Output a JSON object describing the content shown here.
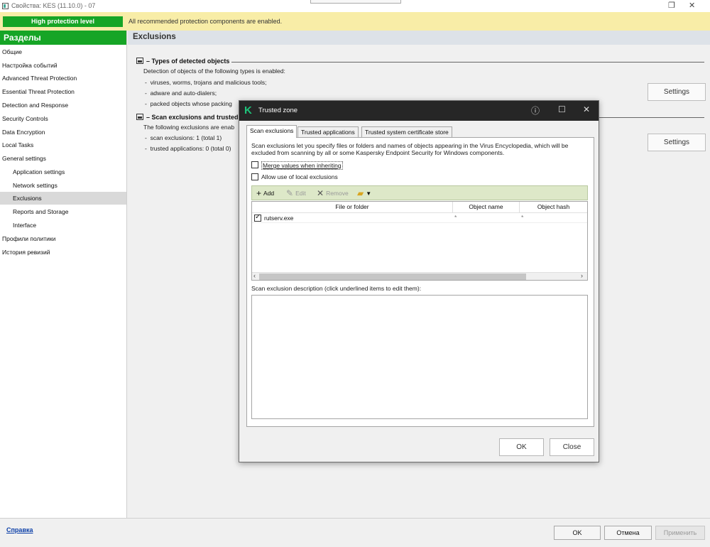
{
  "window": {
    "title": "Свойства: KES (11.10.0) - 07",
    "restore_icon": "restore-icon",
    "close_icon": "close-icon"
  },
  "banner": {
    "level": "High protection level",
    "message": "All recommended protection components are enabled.",
    "level_color": "#16a526",
    "bg_color": "#f8eda7"
  },
  "sidebar": {
    "header": "Разделы",
    "items": [
      {
        "label": "Общие"
      },
      {
        "label": "Настройка событий"
      },
      {
        "label": "Advanced Threat Protection"
      },
      {
        "label": "Essential Threat Protection"
      },
      {
        "label": "Detection and Response"
      },
      {
        "label": "Security Controls"
      },
      {
        "label": "Data Encryption"
      },
      {
        "label": "Local Tasks"
      },
      {
        "label": "General settings"
      },
      {
        "label": "Application settings"
      },
      {
        "label": "Network settings"
      },
      {
        "label": "Exclusions"
      },
      {
        "label": "Reports and Storage"
      },
      {
        "label": "Interface"
      },
      {
        "label": "Профили политики"
      },
      {
        "label": "История ревизий"
      }
    ]
  },
  "content": {
    "header": "Exclusions",
    "section1": {
      "title": "– Types of detected objects",
      "intro": "Detection of objects of the following types is enabled:",
      "lines": [
        "viruses, worms, trojans and malicious tools;",
        "adware and auto-dialers;",
        "packed objects whose packing"
      ],
      "settings": "Settings"
    },
    "section2": {
      "title": "– Scan exclusions and trusted a",
      "intro": "The following exclusions are enab",
      "lines": [
        "scan exclusions: 1 (total 1)",
        "trusted applications: 0 (total 0)"
      ],
      "settings": "Settings"
    },
    "bullet": "-"
  },
  "bottom": {
    "help": "Справка",
    "ok": "OK",
    "cancel": "Отмена",
    "apply": "Применить"
  },
  "dialog": {
    "title": "Trusted zone",
    "logo": "K",
    "help_icon": "help-icon",
    "maximize_icon": "maximize-icon",
    "close_icon": "close-icon",
    "tabs": [
      "Scan exclusions",
      "Trusted applications",
      "Trusted system certificate store"
    ],
    "description": "Scan exclusions let you specify files or folders and names of objects appearing in the Virus Encyclopedia, which will be excluded from scanning by all or some Kaspersky Endpoint Security for Windows components.",
    "merge_label": "Merge values when inheriting",
    "local_label": "Allow use of local exclusions",
    "toolbar": {
      "add": "Add",
      "edit": "Edit",
      "remove": "Remove"
    },
    "columns": [
      "File or folder",
      "Object name",
      "Object hash"
    ],
    "rows": [
      {
        "file": "rutserv.exe",
        "object_name": "*",
        "object_hash": "*"
      }
    ],
    "desc_label": "Scan exclusion description (click underlined items to edit them):",
    "ok": "OK",
    "close": "Close"
  }
}
